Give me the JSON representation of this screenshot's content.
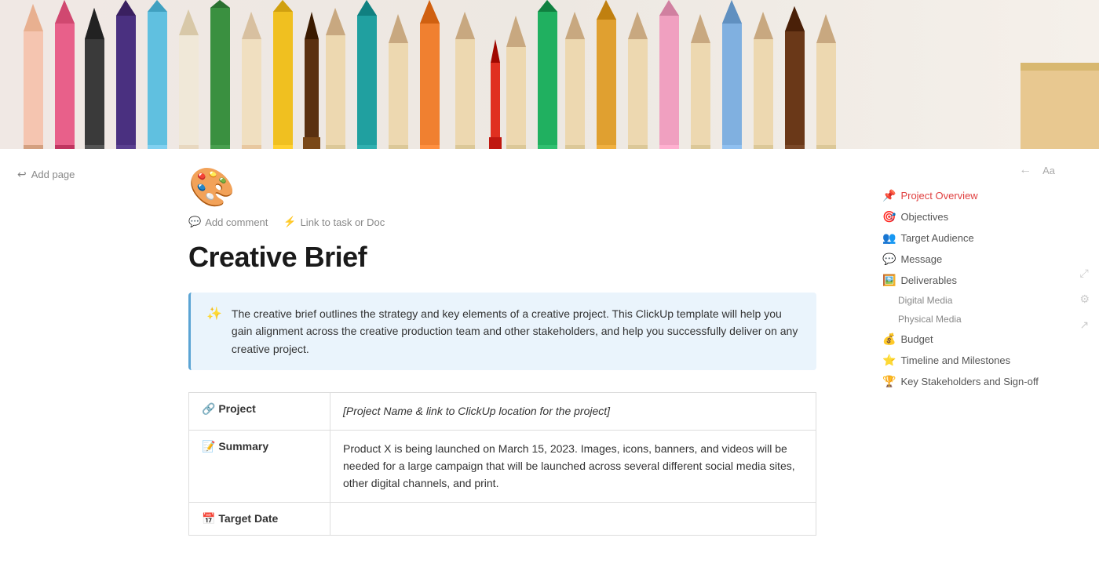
{
  "hero": {
    "alt": "Colorful pencils banner"
  },
  "sidebar_left": {
    "add_page_label": "Add page"
  },
  "toolbar": {
    "add_comment_label": "Add comment",
    "link_to_task_label": "Link to task or Doc"
  },
  "doc": {
    "icon": "🎨",
    "title": "Creative Brief",
    "callout_icon": "✨",
    "callout_text": "The creative brief outlines the strategy and key elements of a creative project. This ClickUp template will help you gain alignment across the creative production team and other stakeholders, and help you successfully deliver on any creative project.",
    "table": {
      "rows": [
        {
          "label_icon": "🔗",
          "label": "Project",
          "value": "[Project Name & link to ClickUp location for the project]",
          "value_style": "italic"
        },
        {
          "label_icon": "📝",
          "label": "Summary",
          "value": "Product X is being launched on March 15, 2023. Images, icons, banners, and videos will be needed for a large campaign that will be launched across several different social media sites, other digital channels, and print.",
          "value_style": "normal"
        },
        {
          "label_icon": "📅",
          "label": "Target Date",
          "value": "",
          "value_style": "normal"
        }
      ]
    }
  },
  "toc": {
    "collapse_icon": "←",
    "font_icon": "Aa",
    "items": [
      {
        "icon": "📌",
        "label": "Project Overview",
        "active": true,
        "sub": false
      },
      {
        "icon": "🎯",
        "label": "Objectives",
        "active": false,
        "sub": false
      },
      {
        "icon": "👥",
        "label": "Target Audience",
        "active": false,
        "sub": false
      },
      {
        "icon": "💬",
        "label": "Message",
        "active": false,
        "sub": false
      },
      {
        "icon": "🖼️",
        "label": "Deliverables",
        "active": false,
        "sub": false
      },
      {
        "icon": "",
        "label": "Digital Media",
        "active": false,
        "sub": true
      },
      {
        "icon": "",
        "label": "Physical Media",
        "active": false,
        "sub": true
      },
      {
        "icon": "💰",
        "label": "Budget",
        "active": false,
        "sub": false
      },
      {
        "icon": "⭐",
        "label": "Timeline and Milestones",
        "active": false,
        "sub": false
      },
      {
        "icon": "🏆",
        "label": "Key Stakeholders and Sign-off",
        "active": false,
        "sub": false
      }
    ]
  },
  "right_tools": {
    "tools": [
      {
        "name": "resize-icon",
        "symbol": "⤢"
      },
      {
        "name": "settings-icon",
        "symbol": "⚙"
      },
      {
        "name": "share-icon",
        "symbol": "↗"
      }
    ]
  }
}
